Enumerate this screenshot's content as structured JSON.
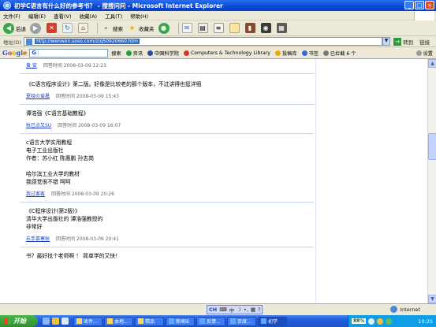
{
  "window": {
    "title": "初学C语言有什么好的参考书？ - 搜搜问问 - Microsoft Internet Explorer",
    "min": "_",
    "max": "□",
    "close": "×"
  },
  "menu": [
    "文件(F)",
    "编辑(E)",
    "查看(V)",
    "收藏(A)",
    "工具(T)",
    "帮助(H)"
  ],
  "toolbar": {
    "back": "后退",
    "search": "搜索",
    "favorites": "收藏夹"
  },
  "address": {
    "label": "地址(D)",
    "url": "http://wenwen.soso.com/z/q50920660.htm",
    "go": "转到",
    "links": "链接"
  },
  "googlebar": {
    "logo": [
      "G",
      "o",
      "o",
      "g",
      "l",
      "e"
    ],
    "search_prefix": "G",
    "items": [
      "搜索",
      "资讯",
      "中国科学院",
      "Computers & Technology Library",
      "投稿库",
      "书签",
      "已拦截 6 个"
    ],
    "settings": "设置"
  },
  "answers": [
    {
      "text": "",
      "user": "黄 安",
      "meta_label": "回答时间",
      "time": "2008-03-09 12:23"
    },
    {
      "text": "《C语言程序设计》第二版。好像是比较老的那个版本，不过讲得也挺详细",
      "user": "夏晓の爱晨",
      "meta_label": "回答时间",
      "time": "2008-03-09 15:43"
    },
    {
      "text": "谭浩强《C语言基础教程》",
      "user": "秋已点又SU",
      "meta_label": "回答时间",
      "time": "2008-03-09 16:07"
    },
    {
      "text": "c语言大学实用教程\n电子工业出版社\n作者：苏小红 陈惠鹏 孙志岗\n\n哈尔滨工业大学的教材\n我感觉很不错 呵呵",
      "user": "我过客客",
      "meta_label": "回答时间",
      "time": "2008-03-09 20:26"
    },
    {
      "text": "《C程序设计(第2版)》\n清华大学出版社的 谭浩强教授的\n非常好",
      "user": "右手慕寒秋",
      "meta_label": "回答时间",
      "time": "2008-03-09 20:41"
    },
    {
      "text": "书？最好找个老师啊 ！   简单学的又快！",
      "user": "",
      "meta_label": "",
      "time": ""
    }
  ],
  "statusbar": {
    "ime_label": "CH",
    "ime_mode": "中",
    "zone": "Internet"
  },
  "taskbar": {
    "start": "开始",
    "tasks": [
      "收件...",
      "本地...",
      "精品",
      "新闻IE",
      "反馈...",
      "百度...",
      "初学"
    ],
    "battery": "88%",
    "clock": "10:25"
  },
  "colors": {
    "link": "#1a3fc4",
    "titlebar": "#0a48d6",
    "taskbar": "#245edb"
  }
}
